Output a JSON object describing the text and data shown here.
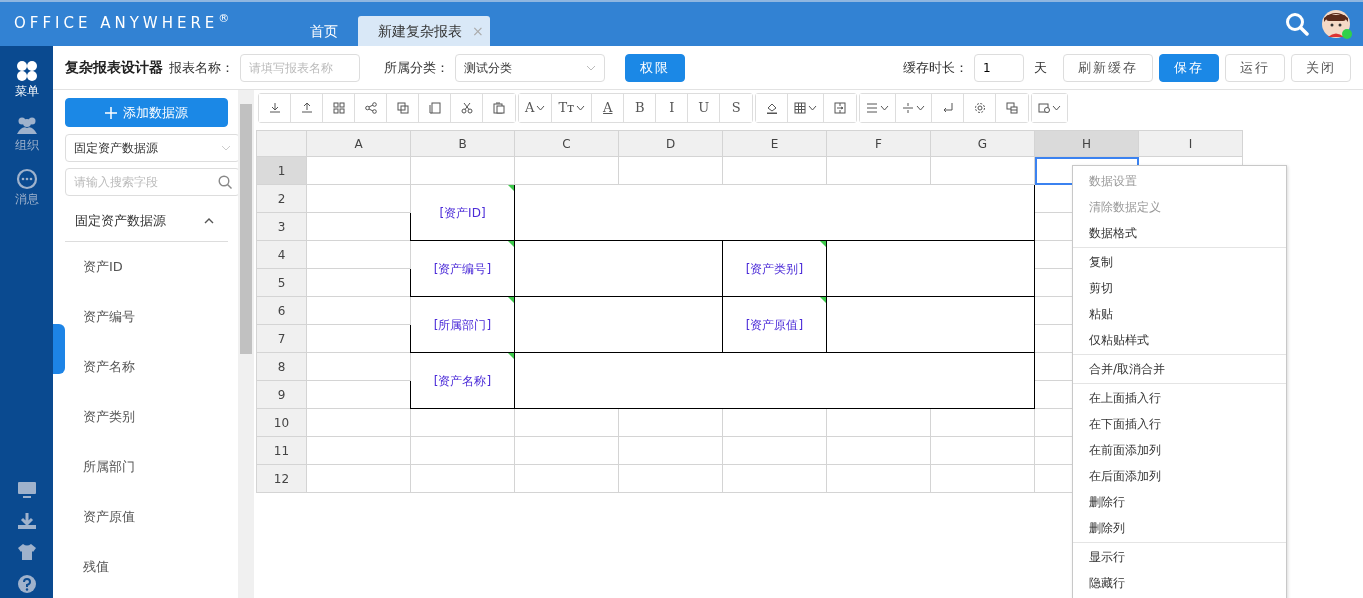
{
  "topbar": {
    "logo": "OFFICE ANYWHERE$^{®}$",
    "tabs": [
      {
        "label": "首页",
        "selected": false
      },
      {
        "label": "新建复杂报表",
        "selected": true,
        "close": "×"
      }
    ],
    "user_online": true
  },
  "nav": {
    "items": [
      {
        "label": "菜单",
        "selected": true
      },
      {
        "label": "组织",
        "selected": false
      },
      {
        "label": "消息",
        "selected": false
      }
    ]
  },
  "header": {
    "title": "复杂报表设计器",
    "name_label": "报表名称：",
    "name_placeholder": "请填写报表名称",
    "category_label": "所属分类：",
    "category_value": "测试分类",
    "permission_button": "权限",
    "cache_label": "缓存时长：",
    "cache_value": "1",
    "cache_unit": "天",
    "buttons": [
      {
        "label": "刷新缓存",
        "primary": false
      },
      {
        "label": "保存",
        "primary": true
      },
      {
        "label": "运行",
        "primary": false
      },
      {
        "label": "关闭",
        "primary": false
      }
    ]
  },
  "fields_panel": {
    "add_button": "添加数据源",
    "source_select": "固定资产数据源",
    "search_placeholder": "请输入搜索字段",
    "group": {
      "label": "固定资产数据源",
      "expanded": true,
      "items": [
        "资产ID",
        "资产编号",
        "资产名称",
        "资产类别",
        "所属部门",
        "资产原值",
        "残值"
      ]
    }
  },
  "toolbar": [
    {
      "buttons": [
        {
          "kind": "icon",
          "dropdown": false
        },
        {
          "kind": "icon",
          "dropdown": false
        },
        {
          "kind": "icon",
          "dropdown": false
        },
        {
          "kind": "icon",
          "dropdown": false
        },
        {
          "kind": "icon",
          "dropdown": false
        },
        {
          "kind": "icon",
          "dropdown": false
        },
        {
          "kind": "icon",
          "dropdown": false
        },
        {
          "kind": "icon",
          "dropdown": false
        }
      ]
    },
    {
      "buttons": [
        {
          "kind": "glyph",
          "glyph": "A",
          "dropdown": true
        },
        {
          "kind": "glyph",
          "glyph": "Tт",
          "dropdown": true
        },
        {
          "kind": "glyph",
          "glyph": "A",
          "underline": true,
          "dropdown": false
        },
        {
          "kind": "glyph",
          "glyph": "B",
          "dropdown": false
        },
        {
          "kind": "glyph",
          "glyph": "I",
          "dropdown": false
        },
        {
          "kind": "glyph",
          "glyph": "U",
          "dropdown": false
        },
        {
          "kind": "glyph",
          "glyph": "S",
          "dropdown": false
        }
      ]
    },
    {
      "buttons": [
        {
          "kind": "icon",
          "dropdown": false
        },
        {
          "kind": "icon",
          "dropdown": true
        },
        {
          "kind": "icon",
          "dropdown": false
        }
      ]
    },
    {
      "buttons": [
        {
          "kind": "icon",
          "dropdown": true
        },
        {
          "kind": "icon",
          "dropdown": true
        },
        {
          "kind": "icon",
          "dropdown": false
        },
        {
          "kind": "icon",
          "dropdown": false
        },
        {
          "kind": "icon",
          "dropdown": false
        }
      ]
    },
    {
      "buttons": [
        {
          "kind": "icon",
          "dropdown": true
        }
      ]
    }
  ],
  "sheet": {
    "columns": [
      {
        "label": "A",
        "selected": false
      },
      {
        "label": "B",
        "selected": false
      },
      {
        "label": "C",
        "selected": false
      },
      {
        "label": "D",
        "selected": false
      },
      {
        "label": "E",
        "selected": false
      },
      {
        "label": "F",
        "selected": false
      },
      {
        "label": "G",
        "selected": false
      },
      {
        "label": "H",
        "selected": true
      },
      {
        "label": "I",
        "selected": false
      }
    ],
    "rows": [
      {
        "label": "1",
        "selected": true
      },
      {
        "label": "2",
        "selected": false
      },
      {
        "label": "3",
        "selected": false
      },
      {
        "label": "4",
        "selected": false
      },
      {
        "label": "5",
        "selected": false
      },
      {
        "label": "6",
        "selected": false
      },
      {
        "label": "7",
        "selected": false
      },
      {
        "label": "8",
        "selected": false
      },
      {
        "label": "9",
        "selected": false
      },
      {
        "label": "10",
        "selected": false
      },
      {
        "label": "11",
        "selected": false
      },
      {
        "label": "12",
        "selected": false
      }
    ],
    "merged_cells": [
      {
        "text": "[资产ID]",
        "bound": true
      },
      {
        "bound": false
      },
      {
        "text": "[资产编号]",
        "bound": true
      },
      {
        "bound": false
      },
      {
        "text": "[资产类别]",
        "bound": true
      },
      {
        "bound": false
      },
      {
        "text": "[所属部门]",
        "bound": true
      },
      {
        "bound": false
      },
      {
        "text": "[资产原值]",
        "bound": true
      },
      {
        "bound": false
      },
      {
        "text": "[资产名称]",
        "bound": true
      },
      {
        "bound": false
      }
    ]
  },
  "context_menu": {
    "groups": [
      [
        {
          "label": "数据设置",
          "disabled": true
        },
        {
          "label": "清除数据定义",
          "disabled": true
        },
        {
          "label": "数据格式",
          "disabled": false
        }
      ],
      [
        {
          "label": "复制",
          "disabled": false
        },
        {
          "label": "剪切",
          "disabled": false
        },
        {
          "label": "粘贴",
          "disabled": false
        },
        {
          "label": "仅粘贴样式",
          "disabled": false
        }
      ],
      [
        {
          "label": "合并/取消合并",
          "disabled": false
        }
      ],
      [
        {
          "label": "在上面插入行",
          "disabled": false
        },
        {
          "label": "在下面插入行",
          "disabled": false
        },
        {
          "label": "在前面添加列",
          "disabled": false
        },
        {
          "label": "在后面添加列",
          "disabled": false
        },
        {
          "label": "删除行",
          "disabled": false
        },
        {
          "label": "删除列",
          "disabled": false
        }
      ],
      [
        {
          "label": "显示行",
          "disabled": false
        },
        {
          "label": "隐藏行",
          "disabled": false
        }
      ]
    ]
  }
}
